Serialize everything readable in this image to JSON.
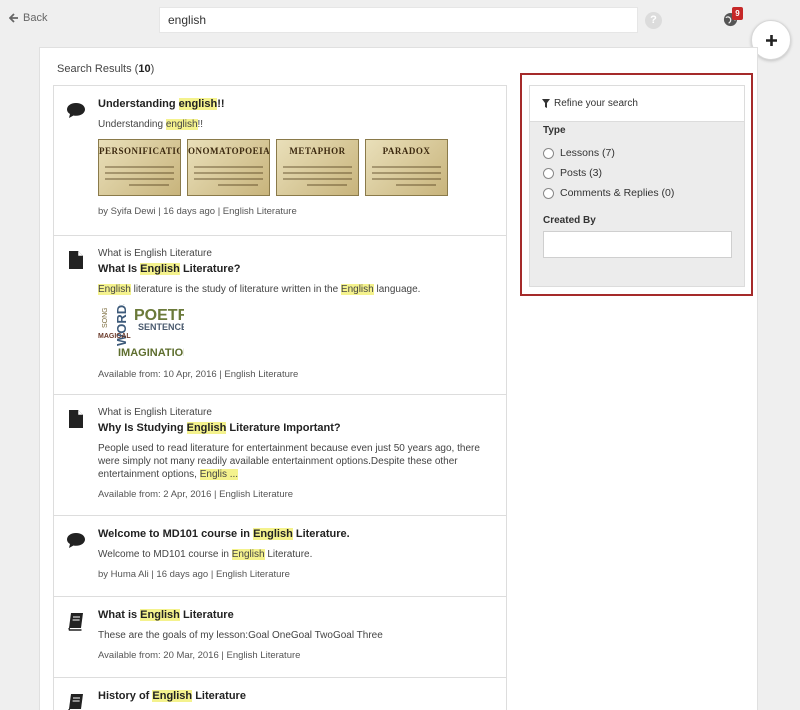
{
  "topbar": {
    "back_label": "Back",
    "search_value": "english",
    "help_label": "?",
    "notification_count": "9"
  },
  "results": {
    "label": "Search Results",
    "count": "10"
  },
  "items": [
    {
      "icon": "speech-bubble-icon",
      "type_label": "",
      "title_pre": "Understanding ",
      "title_mark": "english",
      "title_post": "!!",
      "desc_pre": "Understanding ",
      "desc_mark": "english",
      "desc_post": "!!",
      "thumbs": [
        "PERSONIFICATION",
        "ONOMATOPOEIA",
        "METAPHOR",
        "PARADOX"
      ],
      "footer": "by Syifa Dewi | 16 days ago | English Literature"
    },
    {
      "icon": "document-icon",
      "type_label": "What is English Literature",
      "title_pre": "What Is ",
      "title_mark": "English",
      "title_post": " Literature?",
      "desc_pre": "",
      "desc_mark": "English",
      "desc_post": " literature is the study of literature written in the ",
      "desc_mark2": "English",
      "desc_post2": " language.",
      "wordcloud": [
        "POETRY",
        "SENTENCES",
        "WORDS",
        "IMAGINATION",
        "MAGICAL",
        "SONG"
      ],
      "footer": "Available from: 10 Apr, 2016 | English Literature"
    },
    {
      "icon": "document-icon",
      "type_label": "What is English Literature",
      "title_pre": "Why Is Studying ",
      "title_mark": "English",
      "title_post": " Literature Important?",
      "desc_pre": "People used to read literature for entertainment because even just 50 years ago, there were simply not many readily available entertainment options.Despite these other entertainment options, ",
      "desc_mark": "Englis ...",
      "desc_post": "",
      "footer": "Available from: 2 Apr, 2016 | English Literature"
    },
    {
      "icon": "speech-bubble-icon",
      "type_label": "",
      "title_pre": "Welcome to MD101 course in ",
      "title_mark": "English",
      "title_post": " Literature.",
      "desc_pre": "Welcome to MD101 course in ",
      "desc_mark": "English",
      "desc_post": " Literature.",
      "footer": "by Huma Ali | 16 days ago | English Literature"
    },
    {
      "icon": "book-icon",
      "type_label": "",
      "title_pre": "What is ",
      "title_mark": "English",
      "title_post": " Literature",
      "desc_pre": "These are the goals of my lesson:Goal OneGoal TwoGoal Three",
      "desc_mark": "",
      "desc_post": "",
      "footer": "Available from: 20 Mar, 2016 | English Literature"
    },
    {
      "icon": "book-icon",
      "type_label": "",
      "title_pre": "History of ",
      "title_mark": "English",
      "title_post": " Literature",
      "desc_pre": "",
      "desc_mark": "",
      "desc_post": "",
      "footer": ""
    }
  ],
  "refine": {
    "header": "Refine your search",
    "type_label": "Type",
    "options": [
      "Lessons (7)",
      "Posts (3)",
      "Comments & Replies (0)"
    ],
    "created_by_label": "Created By",
    "created_by_value": ""
  },
  "colors": {
    "highlight": "#f4f28d",
    "outline": "#a52a2a",
    "badge": "#c62828"
  }
}
